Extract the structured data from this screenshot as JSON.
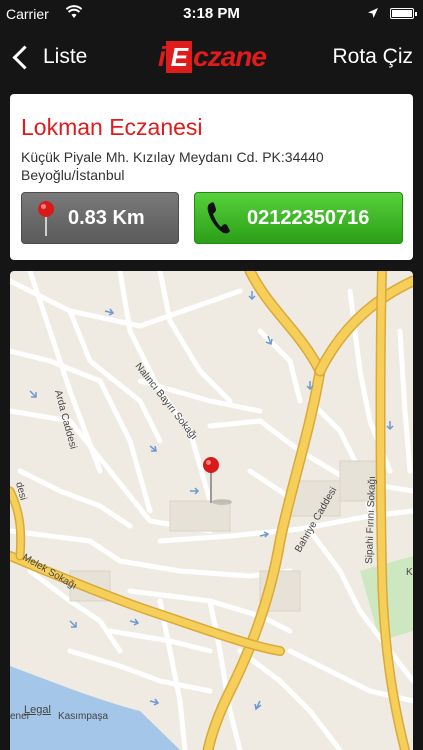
{
  "status_bar": {
    "carrier": "Carrier",
    "time": "3:18 PM"
  },
  "nav": {
    "back_label": "Liste",
    "logo_prefix": "i",
    "logo_letter": "E",
    "logo_rest": "czane",
    "route_label": "Rota Çiz"
  },
  "pharmacy": {
    "name": "Lokman Eczanesi",
    "address_line1": "Küçük Piyale Mh. Kızılay Meydanı Cd. PK:34440",
    "address_line2": "Beyoğlu/İstanbul",
    "distance": "0.83 Km",
    "phone": "02122350716"
  },
  "map": {
    "streets": {
      "nalinci": "Nalıncı Bayırı Sokağı",
      "arda": "Arda Caddesi",
      "bahriye": "Bahriye Caddesi",
      "sipahi": "Sipahi Fırını Sokağı",
      "melek": "Melek Sokağı",
      "desi": "desi",
      "kasimpasa": "Kasımpaşa",
      "ener": "ener",
      "k": "K"
    },
    "legal": "Legal"
  },
  "colors": {
    "accent": "#e01b1b",
    "call_green": "#2b9e17",
    "map_bg": "#efebe2",
    "major_road": "#f6cf5a",
    "water": "#a4c6e8"
  },
  "icons": {
    "back": "chevron-left-icon",
    "pin": "map-pin-icon",
    "phone": "phone-icon",
    "location": "location-arrow-icon",
    "wifi": "wifi-icon",
    "battery": "battery-icon"
  }
}
